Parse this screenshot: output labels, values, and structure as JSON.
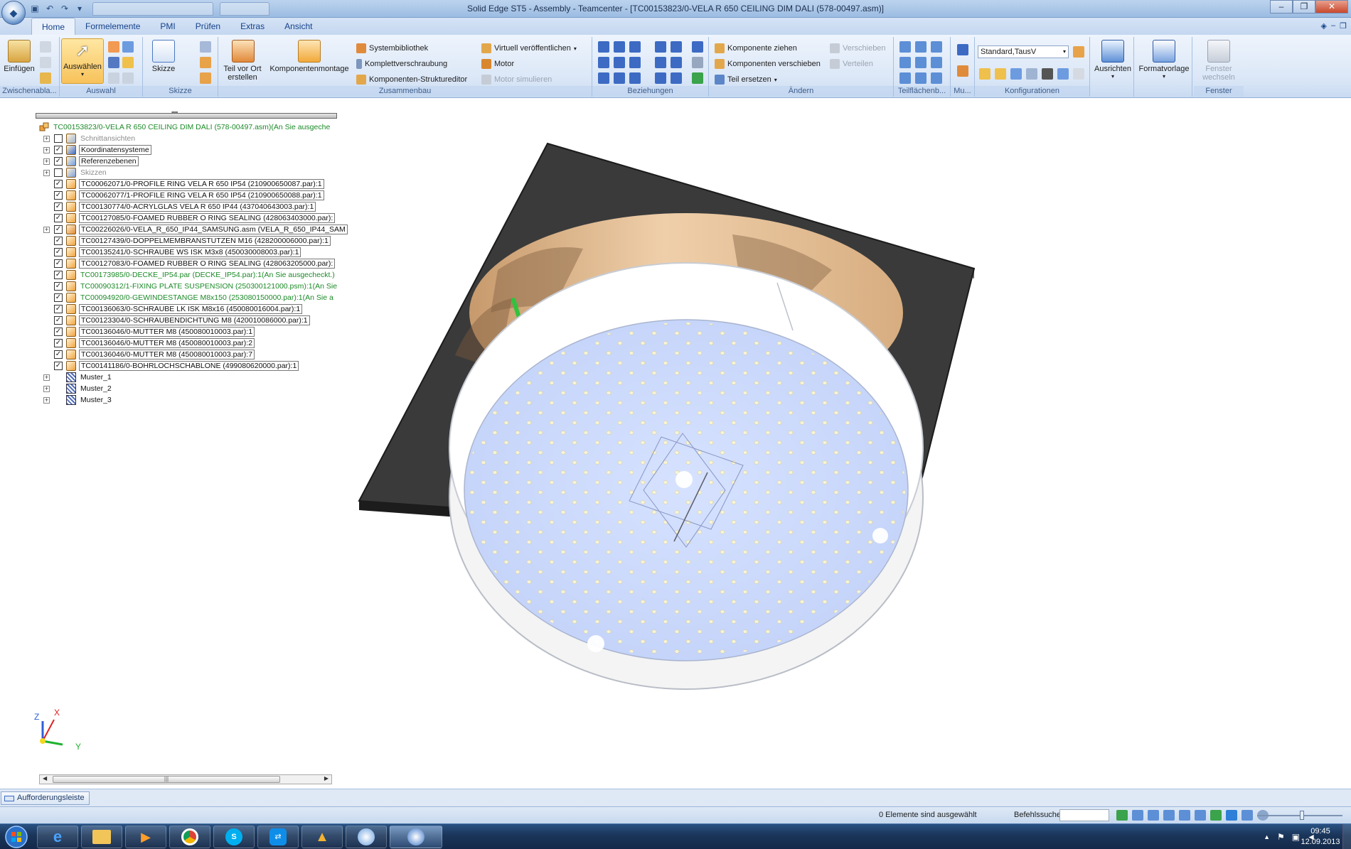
{
  "window": {
    "title": "Solid Edge ST5 - Assembly - Teamcenter - [TC00153823/0-VELA R 650 CEILING DIM DALI (578-00497.asm)]"
  },
  "ribbon_tabs": [
    "Home",
    "Formelemente",
    "PMI",
    "Prüfen",
    "Extras",
    "Ansicht"
  ],
  "ribbon": {
    "clipboard": {
      "label": "Zwischenabla...",
      "paste": "Einfügen"
    },
    "selection": {
      "label": "Auswahl",
      "select": "Auswählen"
    },
    "sketch": {
      "label": "Skizze",
      "sketch": "Skizze"
    },
    "assemble": {
      "label": "Zusammenbau",
      "create_in_place": "Teil vor Ort erstellen",
      "component_assembly": "Komponentenmontage",
      "system_library": "Systembibliothek",
      "full_bolting": "Komplettverschraubung",
      "structure_editor": "Komponenten-Strukturеditor",
      "virtual_publish": "Virtuell veröffentlichen",
      "motor": "Motor",
      "simulate_motor": "Motor simulieren"
    },
    "relations": {
      "label": "Beziehungen"
    },
    "modify": {
      "label": "Ändern",
      "drag_component": "Komponente ziehen",
      "move_components": "Komponenten verschieben",
      "replace_part": "Teil ersetzen",
      "move": "Verschieben",
      "distribute": "Verteilen"
    },
    "face_relations": {
      "label": "Teilflächenb..."
    },
    "mu": {
      "label": "Mu..."
    },
    "configurations": {
      "label": "Konfigurationen",
      "selected": "Standard,TausV"
    },
    "align": {
      "label": "Ausrichten"
    },
    "format_template": {
      "label": "Formatvorlage"
    },
    "window_group": {
      "label": "Fenster",
      "switch_window": "Fenster wechseln"
    }
  },
  "tree": {
    "root": "TC00153823/0-VELA R 650 CEILING DIM DALI (578-00497.asm)(An Sie ausgeche",
    "items": [
      {
        "label": "Schnittansichten",
        "checked": false,
        "expand": true,
        "style": "gray",
        "icon": "section-icon"
      },
      {
        "label": "Koordinatensysteme",
        "checked": true,
        "expand": true,
        "style": "box",
        "icon": "coordinate-icon"
      },
      {
        "label": "Referenzebenen",
        "checked": true,
        "expand": true,
        "style": "box",
        "icon": "plane-icon"
      },
      {
        "label": "Skizzen",
        "checked": false,
        "expand": true,
        "style": "gray",
        "icon": "sketch-icon"
      },
      {
        "label": "TC00062071/0-PROFILE RING VELA R 650 IP54 (210900650087.par):1",
        "checked": true,
        "expand": false,
        "style": "box",
        "icon": "part-icon"
      },
      {
        "label": "TC00062077/1-PROFILE RING VELA R 650 IP54 (210900650088.par):1",
        "checked": true,
        "expand": false,
        "style": "box",
        "icon": "part-icon"
      },
      {
        "label": "TC00130774/0-ACRYLGLAS VELA R 650 IP44 (437040643003.par):1",
        "checked": true,
        "expand": false,
        "style": "box",
        "icon": "part-icon"
      },
      {
        "label": "TC00127085/0-FOAMED RUBBER O RING SEALING (428063403000.par):",
        "checked": true,
        "expand": false,
        "style": "box",
        "icon": "part-icon"
      },
      {
        "label": "TC00226026/0-VELA_R_650_IP44_SAMSUNG.asm (VELA_R_650_IP44_SAM",
        "checked": true,
        "expand": true,
        "style": "box",
        "icon": "assembly-icon"
      },
      {
        "label": "TC00127439/0-DOPPELMEMBRANSTUTZEN M16 (428200006000.par):1",
        "checked": true,
        "expand": false,
        "style": "box",
        "icon": "part-icon"
      },
      {
        "label": "TC00135241/0-SCHRAUBE WS ISK M3x8 (450030008003.par):1",
        "checked": true,
        "expand": false,
        "style": "box",
        "icon": "part-icon"
      },
      {
        "label": "TC00127083/0-FOAMED RUBBER O RING SEALING (428063205000.par):",
        "checked": true,
        "expand": false,
        "style": "box",
        "icon": "part-icon"
      },
      {
        "label": "TC00173985/0-DECKE_IP54.par (DECKE_IP54.par):1(An Sie ausgecheckt.)",
        "checked": true,
        "expand": false,
        "style": "green",
        "icon": "part-icon"
      },
      {
        "label": "TC00090312/1-FIXING PLATE SUSPENSION (250300121000.psm):1(An Sie",
        "checked": true,
        "expand": false,
        "style": "green",
        "icon": "part-icon"
      },
      {
        "label": "TC00094920/0-GEWINDESTANGE M8x150 (253080150000.par):1(An Sie a",
        "checked": true,
        "expand": false,
        "style": "green",
        "icon": "part-icon"
      },
      {
        "label": "TC00136063/0-SCHRAUBE LK ISK M8x16 (450080016004.par):1",
        "checked": true,
        "expand": false,
        "style": "box",
        "icon": "part-icon"
      },
      {
        "label": "TC00123304/0-SCHRAUBENDICHTUNG M8 (420010086000.par):1",
        "checked": true,
        "expand": false,
        "style": "box",
        "icon": "part-icon"
      },
      {
        "label": "TC00136046/0-MUTTER M8 (450080010003.par):1",
        "checked": true,
        "expand": false,
        "style": "box",
        "icon": "part-icon"
      },
      {
        "label": "TC00136046/0-MUTTER M8 (450080010003.par):2",
        "checked": true,
        "expand": false,
        "style": "box",
        "icon": "part-icon"
      },
      {
        "label": "TC00136046/0-MUTTER M8 (450080010003.par):7",
        "checked": true,
        "expand": false,
        "style": "box",
        "icon": "part-icon"
      },
      {
        "label": "TC00141186/0-BOHRLOCHSCHABLONE (499080620000.par):1",
        "checked": true,
        "expand": false,
        "style": "box",
        "icon": "part-icon"
      },
      {
        "label": "Muster_1",
        "checked": null,
        "expand": true,
        "style": "plain",
        "icon": "pattern-icon"
      },
      {
        "label": "Muster_2",
        "checked": null,
        "expand": true,
        "style": "plain",
        "icon": "pattern-icon"
      },
      {
        "label": "Muster_3",
        "checked": null,
        "expand": true,
        "style": "plain",
        "icon": "pattern-icon"
      }
    ]
  },
  "triad": {
    "x": "X",
    "y": "Y",
    "z": "Z"
  },
  "prompt_bar": {
    "label": "Aufforderungsleiste"
  },
  "status": {
    "selection": "0 Elemente sind ausgewählt",
    "command_search": "Befehlssuche"
  },
  "clock": {
    "time": "09:45",
    "date": "12.09.2013"
  },
  "colors": {
    "ribbon": "#dbe7f7",
    "plate": "#3a3a3a",
    "diffuser": "#c9d8fb",
    "ring": "#ffffff",
    "inner_wall": "#e7c7a4",
    "green_status": "#1c8a28"
  }
}
